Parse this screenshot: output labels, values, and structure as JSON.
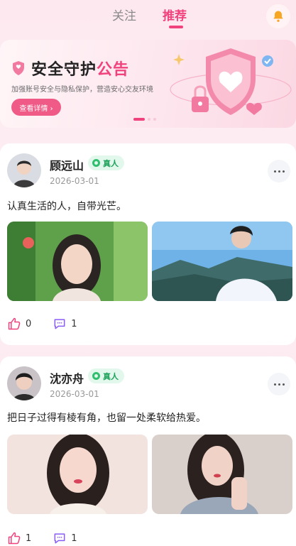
{
  "tabs": {
    "follow": "关注",
    "recommend": "推荐"
  },
  "banner": {
    "title_main": "安全守护",
    "title_accent": "公告",
    "subtitle": "加强账号安全与隐私保护，营造安心交友环境",
    "button_label": "查看详情 ›"
  },
  "posts": [
    {
      "name": "顾远山",
      "badge": "真人",
      "date": "2026-03-01",
      "text": "认真生活的人，自带光芒。",
      "likes": "0",
      "comments": "1"
    },
    {
      "name": "沈亦舟",
      "badge": "真人",
      "date": "2026-03-01",
      "text": "把日子过得有棱有角，也留一处柔软给热爱。",
      "likes": "1",
      "comments": "1"
    }
  ],
  "colors": {
    "accent": "#f0437e",
    "badge_green": "#1ea25b",
    "like_icon": "#f0437e",
    "comment_icon": "#8a5cf6"
  }
}
